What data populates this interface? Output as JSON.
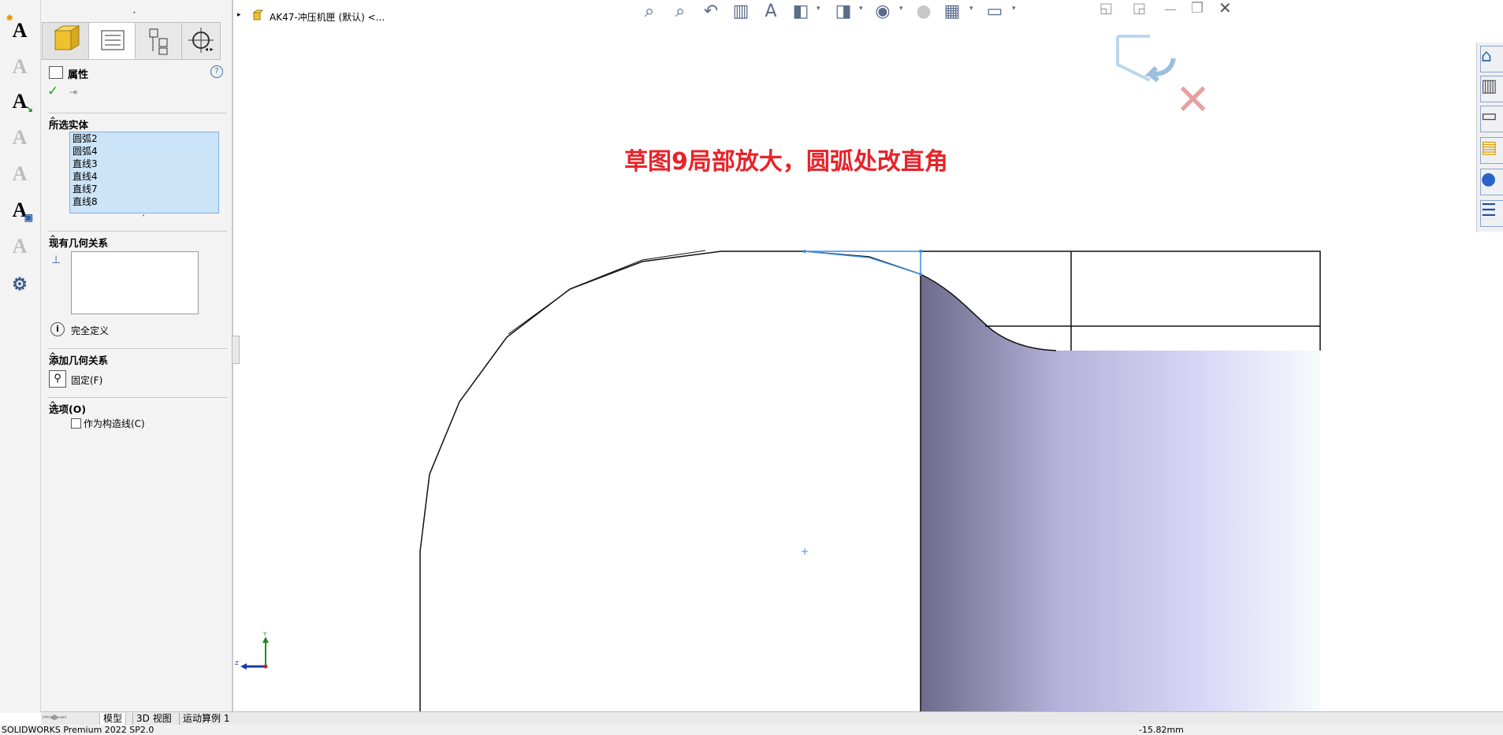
{
  "breadcrumb": {
    "title": "AK47-冲压机匣 (默认) <..."
  },
  "property_manager": {
    "title": "属性",
    "sections": {
      "selected_entities": {
        "title": "所选实体",
        "items": [
          "圆弧2",
          "圆弧4",
          "直线3",
          "直线4",
          "直线7",
          "直线8"
        ]
      },
      "existing_relations": {
        "title": "现有几何关系",
        "status": "完全定义"
      },
      "add_relations": {
        "title": "添加几何关系",
        "fixed_label": "固定(F)"
      },
      "options": {
        "title": "选项(O)",
        "construction_label": "作为构造线(C)"
      }
    }
  },
  "annotation": {
    "text": "草图9局部放大，圆弧处改直角",
    "color": "#e8232a"
  },
  "triad": {
    "y_label": "Y",
    "z_label": "Z"
  },
  "bottom_tabs": {
    "model": "模型",
    "view3d": "3D 视图",
    "motion": "运动算例 1"
  },
  "status_bar": {
    "product": "SOLIDWORKS Premium 2022 SP2.0",
    "coordinate": "-15.82mm"
  },
  "colors": {
    "accent": "#3a8ee6",
    "selection_bg": "#cce4f7",
    "confirm_green": "#22a02c",
    "cancel_red": "#e8a0a0"
  }
}
